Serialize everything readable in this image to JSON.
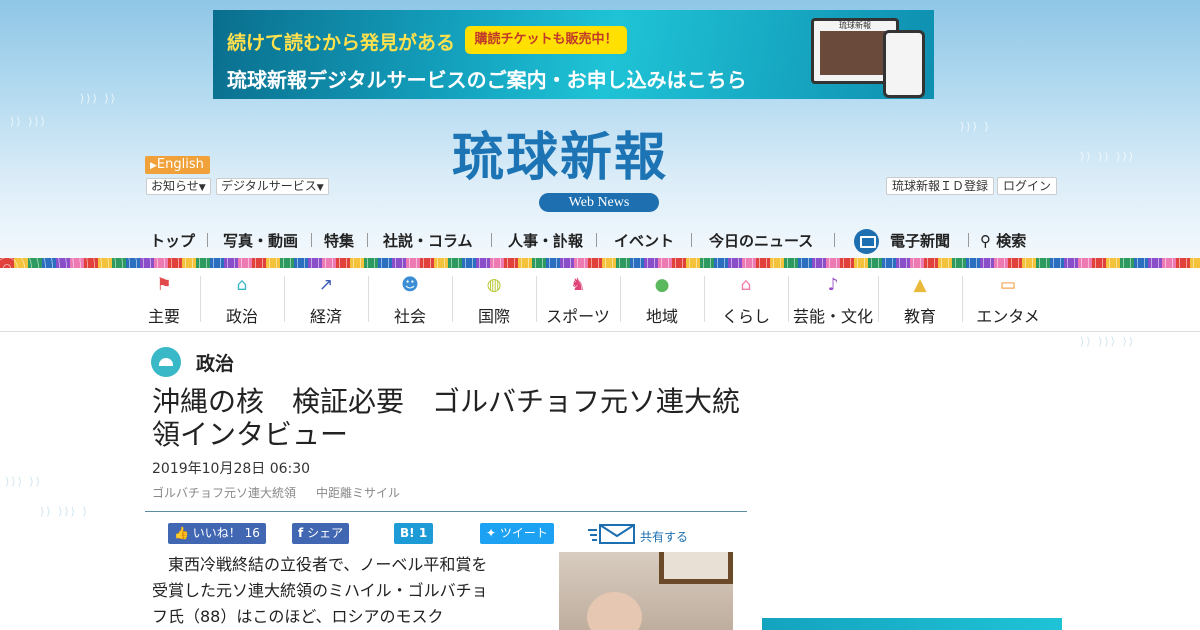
{
  "banner": {
    "line1": "続けて読むから発見がある",
    "badge": "購読チケットも販売中！",
    "line2": "琉球新報デジタルサービスのご案内・お申し込みはこちら",
    "device_title": "琉球新報"
  },
  "masthead": {
    "logo": "琉球新報",
    "web_news": "Web News",
    "english": "English",
    "notice": "お知らせ",
    "digital_service": "デジタルサービス",
    "id_register": "琉球新報ＩＤ登録",
    "login": "ログイン"
  },
  "mainnav": {
    "items": [
      "トップ",
      "写真・動画",
      "特集",
      "社説・コラム",
      "人事・訃報",
      "イベント",
      "今日のニュース"
    ],
    "epaper": "電子新聞",
    "search": "検索"
  },
  "categories": [
    {
      "label": "主要",
      "icon": "flag-icon",
      "color": "#e04a4a"
    },
    {
      "label": "政治",
      "icon": "parliament-icon",
      "color": "#39b8c8"
    },
    {
      "label": "経済",
      "icon": "trend-chart-icon",
      "color": "#3b5bb5"
    },
    {
      "label": "社会",
      "icon": "people-icon",
      "color": "#3b8ed6"
    },
    {
      "label": "国際",
      "icon": "globe-icon",
      "color": "#b8c83a"
    },
    {
      "label": "スポーツ",
      "icon": "runner-icon",
      "color": "#e0457a"
    },
    {
      "label": "地域",
      "icon": "map-pin-icon",
      "color": "#5cb85c"
    },
    {
      "label": "くらし",
      "icon": "house-icon",
      "color": "#ef7aa8"
    },
    {
      "label": "芸能・文化",
      "icon": "sanshin-icon",
      "color": "#9a4fc8"
    },
    {
      "label": "教育",
      "icon": "graduation-cap-icon",
      "color": "#e8b93a"
    },
    {
      "label": "エンタメ",
      "icon": "tv-icon",
      "color": "#f0932b"
    }
  ],
  "article": {
    "category": "政治",
    "title": "沖縄の核　検証必要　ゴルバチョフ元ソ連大統領インタビュー",
    "date": "2019年10月28日 06:30",
    "tags": [
      "ゴルバチョフ元ソ連大統領",
      "中距離ミサイル"
    ],
    "body": "東西冷戦終結の立役者で、ノーベル平和賞を受賞した元ソ連大統領のミハイル・ゴルバチョフ氏（88）はこのほど、ロシアのモスク"
  },
  "share": {
    "like_label": "いいね！",
    "like_count": "16",
    "fb_share": "シェア",
    "hatena": "B!",
    "hatena_count": "1",
    "tweet": "ツイート",
    "share_all": "共有する"
  }
}
